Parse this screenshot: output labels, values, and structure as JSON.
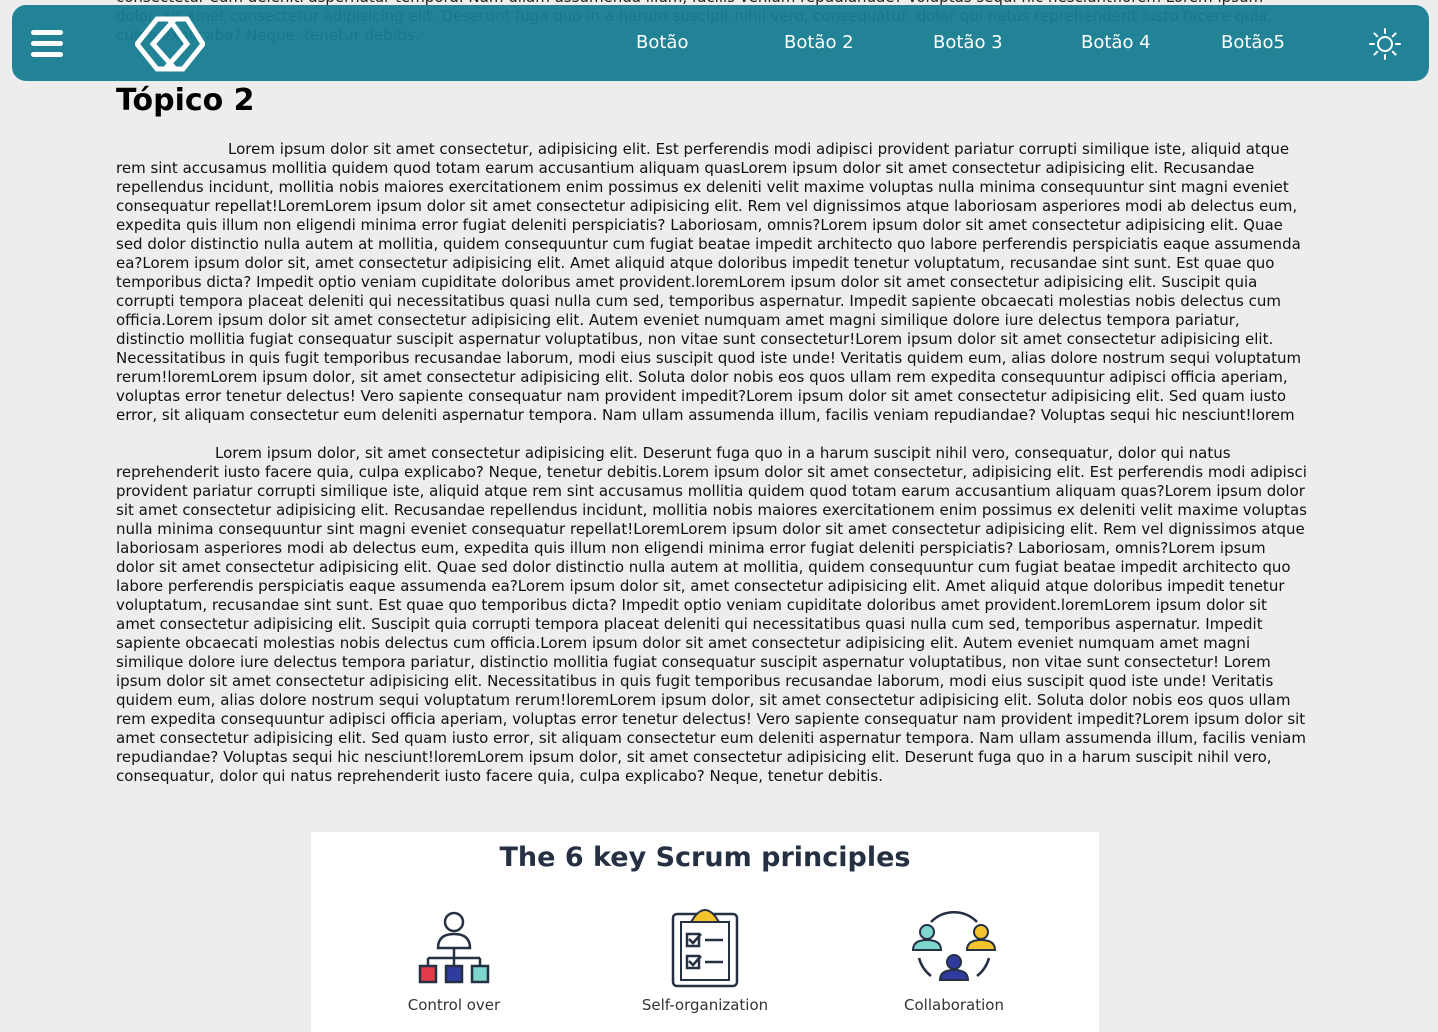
{
  "background_text": {
    "lines": "consectetur eum deleniti aspernatur tempora. Nam ullam assumenda illum, facilis veniam repudiandae? Voluptas sequi hic nesciunt!lorem Lorem ipsum dolor, sit amet consectetur adipisicing elit. Deserunt fuga quo in a harum suscipit nihil vero, consequatur, dolor qui natus reprehenderit iusto facere quia, culpa explicabo? Neque, tenetur debitis."
  },
  "header": {
    "menu_icon": "hamburger-menu-icon",
    "logo_icon": "diamond-logo-icon",
    "nav": [
      "Botão",
      "Botão 2",
      "Botão 3",
      "Botão 4",
      "Botão5"
    ],
    "theme_icon": "sun-icon",
    "color": "#157c92"
  },
  "main": {
    "topic_title": "Tópico 2",
    "paragraph_1": "Lorem ipsum dolor sit amet consectetur, adipisicing elit. Est perferendis modi adipisci provident pariatur corrupti similique iste, aliquid atque rem sint accusamus mollitia quidem quod totam earum accusantium aliquam quasLorem ipsum dolor sit amet consectetur adipisicing elit. Recusandae repellendus incidunt, mollitia nobis maiores exercitationem enim possimus ex deleniti velit maxime voluptas nulla minima consequuntur sint magni eveniet consequatur repellat!LoremLorem ipsum dolor sit amet consectetur adipisicing elit. Rem vel dignissimos atque laboriosam asperiores modi ab delectus eum, expedita quis illum non eligendi minima error fugiat deleniti perspiciatis? Laboriosam, omnis?Lorem ipsum dolor sit amet consectetur adipisicing elit. Quae sed dolor distinctio nulla autem at mollitia, quidem consequuntur cum fugiat beatae impedit architecto quo labore perferendis perspiciatis eaque assumenda ea?Lorem ipsum dolor sit, amet consectetur adipisicing elit. Amet aliquid atque doloribus impedit tenetur voluptatum, recusandae sint sunt. Est quae quo temporibus dicta? Impedit optio veniam cupiditate doloribus amet provident.loremLorem ipsum dolor sit amet consectetur adipisicing elit. Suscipit quia corrupti tempora placeat deleniti qui necessitatibus quasi nulla cum sed, temporibus aspernatur. Impedit sapiente obcaecati molestias nobis delectus cum officia.Lorem ipsum dolor sit amet consectetur adipisicing elit. Autem eveniet numquam amet magni similique dolore iure delectus tempora pariatur, distinctio mollitia fugiat consequatur suscipit aspernatur voluptatibus, non vitae sunt consectetur!Lorem ipsum dolor sit amet consectetur adipisicing elit. Necessitatibus in quis fugit temporibus recusandae laborum, modi eius suscipit quod iste unde! Veritatis quidem eum, alias dolore nostrum sequi voluptatum rerum!loremLorem ipsum dolor, sit amet consectetur adipisicing elit. Soluta dolor nobis eos quos ullam rem expedita consequuntur adipisci officia aperiam, voluptas error tenetur delectus! Vero sapiente consequatur nam provident impedit?Lorem ipsum dolor sit amet consectetur adipisicing elit. Sed quam iusto error, sit aliquam consectetur eum deleniti aspernatur tempora. Nam ullam assumenda illum, facilis veniam repudiandae? Voluptas sequi hic nesciunt!lorem",
    "paragraph_2": "Lorem ipsum dolor, sit amet consectetur adipisicing elit. Deserunt fuga quo in a harum suscipit nihil vero, consequatur, dolor qui natus reprehenderit iusto facere quia, culpa explicabo? Neque, tenetur debitis.Lorem ipsum dolor sit amet consectetur, adipisicing elit. Est perferendis modi adipisci provident pariatur corrupti similique iste, aliquid atque rem sint accusamus mollitia quidem quod totam earum accusantium aliquam quas?Lorem ipsum dolor sit amet consectetur adipisicing elit. Recusandae repellendus incidunt, mollitia nobis maiores exercitationem enim possimus ex deleniti velit maxime voluptas nulla minima consequuntur sint magni eveniet consequatur repellat!LoremLorem ipsum dolor sit amet consectetur adipisicing elit. Rem vel dignissimos atque laboriosam asperiores modi ab delectus eum, expedita quis illum non eligendi minima error fugiat deleniti perspiciatis? Laboriosam, omnis?Lorem ipsum dolor sit amet consectetur adipisicing elit. Quae sed dolor distinctio nulla autem at mollitia, quidem consequuntur cum fugiat beatae impedit architecto quo labore perferendis perspiciatis eaque assumenda ea?Lorem ipsum dolor sit, amet consectetur adipisicing elit. Amet aliquid atque doloribus impedit tenetur voluptatum, recusandae sint sunt. Est quae quo temporibus dicta? Impedit optio veniam cupiditate doloribus amet provident.loremLorem ipsum dolor sit amet consectetur adipisicing elit. Suscipit quia corrupti tempora placeat deleniti qui necessitatibus quasi nulla cum sed, temporibus aspernatur. Impedit sapiente obcaecati molestias nobis delectus cum officia.Lorem ipsum dolor sit amet consectetur adipisicing elit. Autem eveniet numquam amet magni similique dolore iure delectus tempora pariatur, distinctio mollitia fugiat consequatur suscipit aspernatur voluptatibus, non vitae sunt consectetur! Lorem ipsum dolor sit amet consectetur adipisicing elit. Necessitatibus in quis fugit temporibus recusandae laborum, modi eius suscipit quod iste unde! Veritatis quidem eum, alias dolore nostrum sequi voluptatum rerum!loremLorem ipsum dolor, sit amet consectetur adipisicing elit. Soluta dolor nobis eos quos ullam rem expedita consequuntur adipisci officia aperiam, voluptas error tenetur delectus! Vero sapiente consequatur nam provident impedit?Lorem ipsum dolor sit amet consectetur adipisicing elit. Sed quam iusto error, sit aliquam consectetur eum deleniti aspernatur tempora. Nam ullam assumenda illum, facilis veniam repudiandae? Voluptas sequi hic nesciunt!loremLorem ipsum dolor, sit amet consectetur adipisicing elit. Deserunt fuga quo in a harum suscipit nihil vero, consequatur, dolor qui natus reprehenderit iusto facere quia, culpa explicabo? Neque, tenetur debitis."
  },
  "figure": {
    "title": "The 6 key Scrum principles",
    "principles": [
      {
        "label": "Control over",
        "icon": "hierarchy-icon"
      },
      {
        "label": "Self-organization",
        "icon": "checklist-clipboard-icon"
      },
      {
        "label": "Collaboration",
        "icon": "team-collaboration-icon"
      }
    ]
  }
}
